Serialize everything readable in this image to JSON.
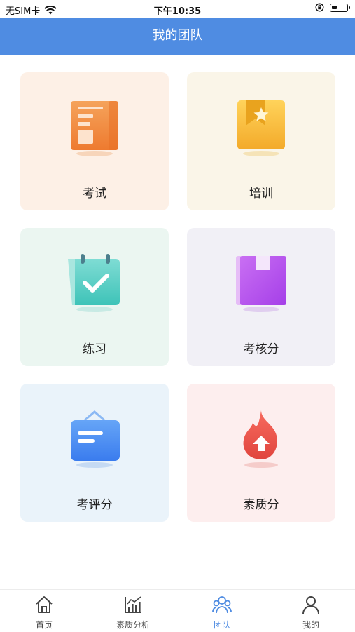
{
  "status": {
    "carrier": "无SIM卡",
    "time": "下午10:35"
  },
  "navbar": {
    "title": "我的团队"
  },
  "cards": [
    {
      "label": "考试",
      "icon": "exam-document-icon",
      "bg": "#fdf0e6"
    },
    {
      "label": "培训",
      "icon": "training-star-book-icon",
      "bg": "#faf5e8"
    },
    {
      "label": "练习",
      "icon": "practice-calendar-check-icon",
      "bg": "#ebf6f1"
    },
    {
      "label": "考核分",
      "icon": "assessment-score-book-icon",
      "bg": "#f1f0f6"
    },
    {
      "label": "考评分",
      "icon": "evaluation-score-folder-icon",
      "bg": "#eaf3fa"
    },
    {
      "label": "素质分",
      "icon": "quality-score-flame-icon",
      "bg": "#fdeeee"
    }
  ],
  "tabbar": [
    {
      "label": "首页",
      "icon": "home-icon"
    },
    {
      "label": "素质分析",
      "icon": "chart-analysis-icon"
    },
    {
      "label": "团队",
      "icon": "team-icon",
      "active": true
    },
    {
      "label": "我的",
      "icon": "user-profile-icon"
    }
  ],
  "colors": {
    "primary": "#4f8ce2",
    "tab_inactive": "#444444"
  }
}
